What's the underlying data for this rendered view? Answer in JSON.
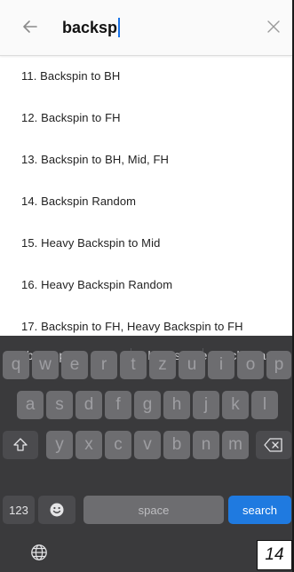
{
  "search": {
    "value": "backsp"
  },
  "results": [
    "11. Backspin to BH",
    "12. Backspin to FH",
    "13. Backspin to BH, Mid, FH",
    "14. Backspin Random",
    "15. Heavy Backspin to Mid",
    "16. Heavy Backspin Random",
    "17. Backspin to FH, Heavy Backspin to FH"
  ],
  "keyboard": {
    "suggestions": [
      "“backsp”",
      "backspace",
      "backsplash"
    ],
    "row1": [
      "q",
      "w",
      "e",
      "r",
      "t",
      "z",
      "u",
      "i",
      "o",
      "p"
    ],
    "row2": [
      "a",
      "s",
      "d",
      "f",
      "g",
      "h",
      "j",
      "k",
      "l"
    ],
    "row3": [
      "y",
      "x",
      "c",
      "v",
      "b",
      "n",
      "m"
    ],
    "numbers_label": "123",
    "space_label": "space",
    "search_label": "search"
  },
  "page_number": "14",
  "colors": {
    "accent": "#1f7ae0",
    "keyboard_bg": "#3a3a3c"
  }
}
